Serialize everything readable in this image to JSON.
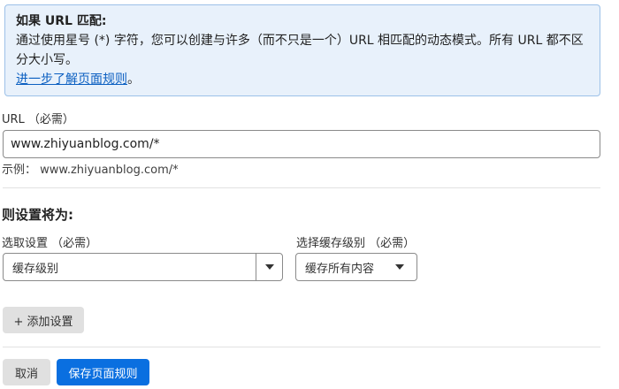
{
  "info": {
    "title": "如果 URL 匹配:",
    "body": "通过使用星号 (*) 字符，您可以创建与许多（而不只是一个）URL 相匹配的动态模式。所有 URL 都不区分大小写。",
    "link": "进一步了解页面规则",
    "link_suffix": "。"
  },
  "url": {
    "label": "URL （必需）",
    "value": "www.zhiyuanblog.com/*",
    "example": "示例： www.zhiyuanblog.com/*"
  },
  "settings": {
    "title": "则设置将为:",
    "pick_label": "选取设置 （必需）",
    "pick_value": "缓存级别",
    "level_label": "选择缓存级别 （必需）",
    "level_value": "缓存所有内容"
  },
  "buttons": {
    "add": "+ 添加设置",
    "cancel": "取消",
    "save": "保存页面规则"
  },
  "colors": {
    "info_bg": "#e8f1fb",
    "info_border": "#9cc1e8",
    "primary": "#0a6fe0",
    "link": "#0b5fc1"
  }
}
